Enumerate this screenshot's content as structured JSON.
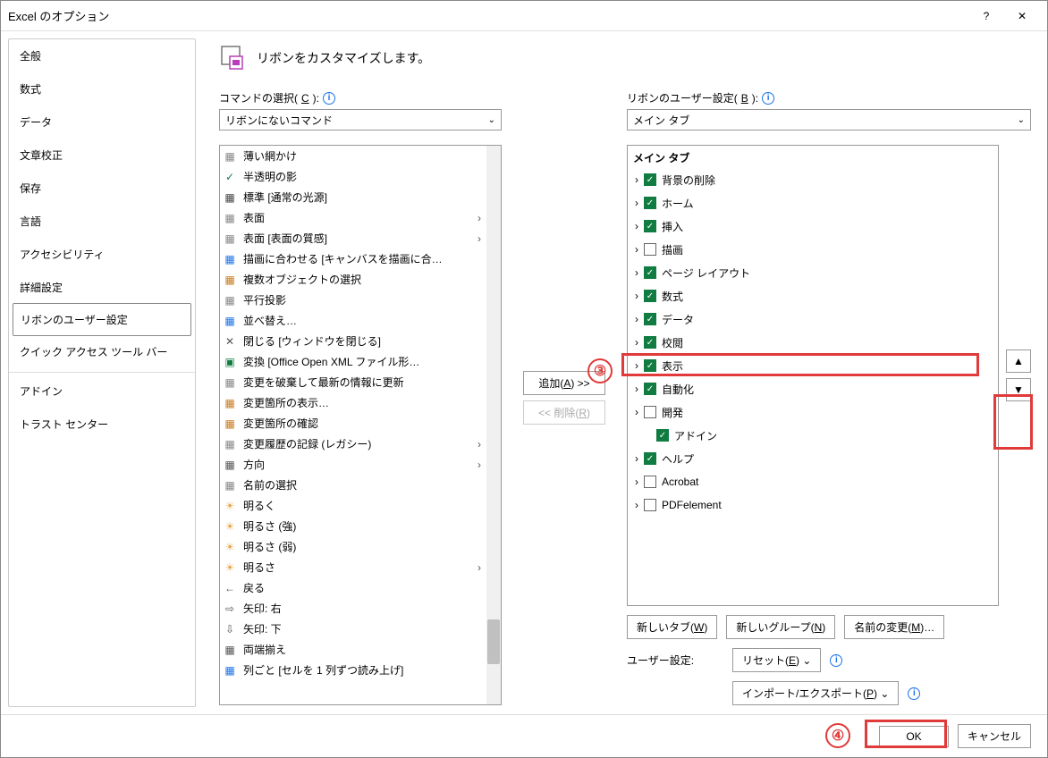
{
  "title": "Excel のオプション",
  "sidebar": [
    {
      "label": "全般"
    },
    {
      "label": "数式"
    },
    {
      "label": "データ"
    },
    {
      "label": "文章校正"
    },
    {
      "label": "保存"
    },
    {
      "label": "言語"
    },
    {
      "label": "アクセシビリティ"
    },
    {
      "label": "詳細設定"
    },
    {
      "label": "リボンのユーザー設定",
      "selected": true,
      "sep": true
    },
    {
      "label": "クイック アクセス ツール バー"
    },
    {
      "label": "アドイン",
      "sep": true
    },
    {
      "label": "トラスト センター"
    }
  ],
  "heading": "リボンをカスタマイズします。",
  "left": {
    "section_label_pre": "コマンドの選択(",
    "section_label_key": "C",
    "section_label_post": "):",
    "dropdown_value": "リボンにないコマンド",
    "commands": [
      {
        "label": "薄い網かけ",
        "iconColor": "#888"
      },
      {
        "label": "半透明の影",
        "iconColor": "#107c41",
        "checkIcon": true
      },
      {
        "label": "標準 [通常の光源]",
        "iconColor": "#444"
      },
      {
        "label": "表面",
        "iconColor": "#888",
        "sub": true
      },
      {
        "label": "表面 [表面の質感]",
        "iconColor": "#888",
        "sub": true
      },
      {
        "label": "描画に合わせる [キャンバスを描画に合…",
        "iconColor": "#1a73e8"
      },
      {
        "label": "複数オブジェクトの選択",
        "iconColor": "#c77a1c"
      },
      {
        "label": "平行投影",
        "iconColor": "#888"
      },
      {
        "label": "並べ替え…",
        "iconColor": "#1a73e8"
      },
      {
        "label": "閉じる [ウィンドウを閉じる]",
        "iconColor": "#555",
        "closeIcon": true
      },
      {
        "label": "変換 [Office Open XML ファイル形…",
        "iconColor": "#107c41",
        "excelIcon": true
      },
      {
        "label": "変更を破棄して最新の情報に更新",
        "iconColor": "#888"
      },
      {
        "label": "変更箇所の表示…",
        "iconColor": "#c77a1c"
      },
      {
        "label": "変更箇所の確認",
        "iconColor": "#c77a1c"
      },
      {
        "label": "変更履歴の記録 (レガシー)",
        "iconColor": "#888",
        "sub": true
      },
      {
        "label": "方向",
        "iconColor": "#555",
        "sub": true
      },
      {
        "label": "名前の選択",
        "iconColor": "#888"
      },
      {
        "label": "明るく",
        "iconColor": "#e8a33d"
      },
      {
        "label": "明るさ (強)",
        "iconColor": "#e8a33d"
      },
      {
        "label": "明るさ (弱)",
        "iconColor": "#e8a33d"
      },
      {
        "label": "明るさ",
        "iconColor": "#e8a33d",
        "sub": true
      },
      {
        "label": "戻る",
        "iconColor": "#555",
        "arrowLeft": true
      },
      {
        "label": "矢印: 右",
        "iconColor": "#555",
        "arrowRight": true
      },
      {
        "label": "矢印: 下",
        "iconColor": "#555",
        "arrowDown": true
      },
      {
        "label": "両端揃え",
        "iconColor": "#555"
      },
      {
        "label": "列ごと [セルを 1 列ずつ読み上げ]",
        "iconColor": "#1a73e8"
      }
    ]
  },
  "middle": {
    "add_label_pre": "追加(",
    "add_label_key": "A",
    "add_label_post": ") >>",
    "remove_label_pre": "<< 削除(",
    "remove_label_key": "R",
    "remove_label_post": ")"
  },
  "right": {
    "section_label_pre": "リボンのユーザー設定(",
    "section_label_key": "B",
    "section_label_post": "):",
    "dropdown_value": "メイン タブ",
    "tree_header": "メイン タブ",
    "nodes": [
      {
        "label": "背景の削除",
        "checked": true
      },
      {
        "label": "ホーム",
        "checked": true
      },
      {
        "label": "挿入",
        "checked": true
      },
      {
        "label": "描画",
        "checked": false
      },
      {
        "label": "ページ レイアウト",
        "checked": true
      },
      {
        "label": "数式",
        "checked": true
      },
      {
        "label": "データ",
        "checked": true
      },
      {
        "label": "校閲",
        "checked": true,
        "highlighted": true
      },
      {
        "label": "表示",
        "checked": true
      },
      {
        "label": "自動化",
        "checked": true
      },
      {
        "label": "開発",
        "checked": false
      },
      {
        "label": "アドイン",
        "checked": true,
        "noCaret": true,
        "indent": true
      },
      {
        "label": "ヘルプ",
        "checked": true
      },
      {
        "label": "Acrobat",
        "checked": false
      },
      {
        "label": "PDFelement",
        "checked": false
      }
    ],
    "new_tab_label": "新しいタブ(W)",
    "new_group_label": "新しいグループ(N)",
    "rename_label": "名前の変更(M)…",
    "user_settings_label": "ユーザー設定:",
    "reset_label": "リセット(E)",
    "import_export_label": "インポート/エクスポート(P)"
  },
  "footer": {
    "ok": "OK",
    "cancel": "キャンセル"
  },
  "annotations": {
    "num3": "③",
    "num4": "④"
  }
}
